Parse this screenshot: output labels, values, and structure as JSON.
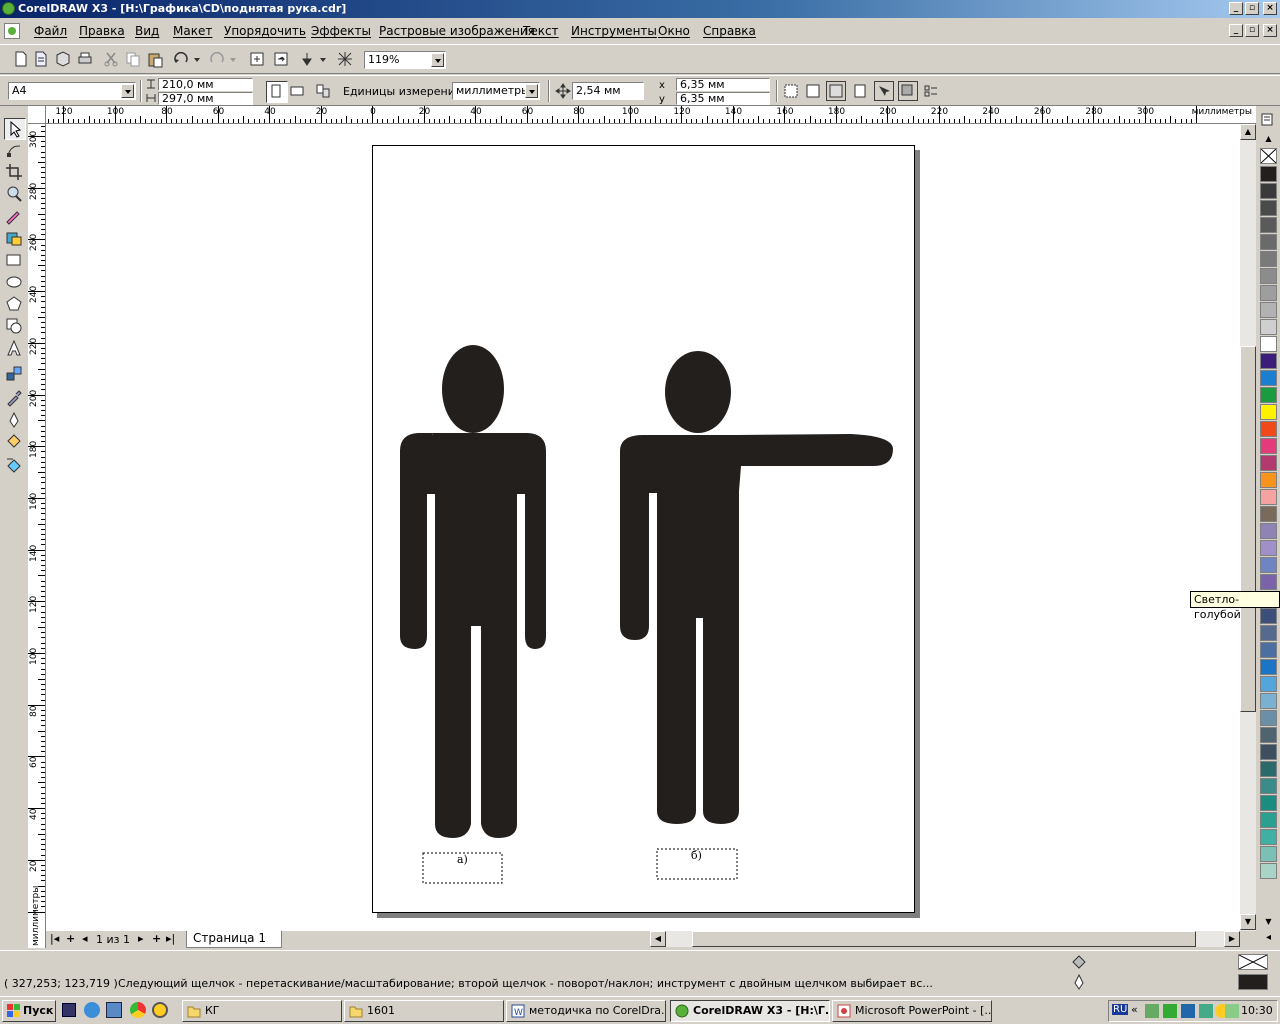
{
  "window": {
    "title": "CorelDRAW X3 - [H:\\Графика\\CD\\поднятая рука.cdr]",
    "controls": [
      "_",
      "▫",
      "×"
    ]
  },
  "menu": {
    "items": [
      "Файл",
      "Правка",
      "Вид",
      "Макет",
      "Упорядочить",
      "Эффекты",
      "Растровые изображения",
      "Текст",
      "Инструменты",
      "Окно",
      "Справка"
    ]
  },
  "standard_toolbar": {
    "zoom": "119%"
  },
  "property_bar": {
    "paper_size": "A4",
    "width": "210,0 мм",
    "height": "297,0 мм",
    "units_label": "Единицы измерения:",
    "units_value": "миллиметры",
    "nudge": "2,54 мм",
    "dup_x": "6,35 мм",
    "dup_y": "6,35 мм"
  },
  "rulers": {
    "unit": "миллиметры",
    "h_labels": [
      "120",
      "100",
      "80",
      "60",
      "40",
      "20",
      "0",
      "20",
      "40",
      "60",
      "80",
      "100",
      "120",
      "140",
      "160",
      "180",
      "200",
      "220",
      "240",
      "260",
      "280",
      "300"
    ],
    "v_labels": [
      "300",
      "280",
      "260",
      "240",
      "220",
      "200",
      "180",
      "160",
      "140",
      "120",
      "100",
      "80",
      "60",
      "40",
      "20"
    ]
  },
  "document": {
    "caption_a": "а)",
    "caption_b": "б)",
    "figure_color": "#231f1c"
  },
  "palette": {
    "tooltip": "Светло-голубой",
    "colors": [
      "#231f1c",
      "#3a3a3a",
      "#4a4a4a",
      "#5a5a5a",
      "#6a6a6a",
      "#7a7a7a",
      "#8c8c8c",
      "#9e9e9e",
      "#b2b2b2",
      "#cfcfcf",
      "#ffffff",
      "#3c1e7a",
      "#1a7fd0",
      "#1a9c3e",
      "#fff200",
      "#f04a1a",
      "#e43c7a",
      "#b23a6e",
      "#f7941d",
      "#f5a3a0",
      "#7a6a5c",
      "#8f82b5",
      "#a18fc7",
      "#6f85c2",
      "#7a63a8",
      "#5a5a8a",
      "#3e4e7a",
      "#56698f",
      "#4a6fa0",
      "#1c74c4",
      "#52a6dc",
      "#7ab0d0",
      "#6a90a8",
      "#50646f",
      "#3e5060",
      "#2a6a6a",
      "#3a8c8a",
      "#1a8c80",
      "#2aa090",
      "#40b0a4",
      "#7ac0b4",
      "#a8d4c8"
    ]
  },
  "page_nav": {
    "counter": "1 из 1",
    "tab": "Страница 1"
  },
  "status": {
    "coords": "( 327,253; 123,719 )",
    "hint": "Следующий щелчок - перетаскивание/масштабирование; второй щелчок - поворот/наклон; инструмент с двойным щелчком выбирает вс..."
  },
  "taskbar": {
    "start": "Пуск",
    "tasks": [
      "КГ",
      "1601",
      "методичка по CorelDra...",
      "CorelDRAW X3 - [H:\\Г...",
      "Microsoft PowerPoint - [..."
    ],
    "lang": "RU",
    "clock": "10:30"
  }
}
